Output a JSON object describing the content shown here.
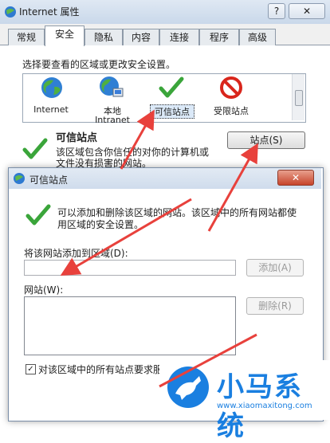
{
  "outer_window": {
    "title": "Internet 属性",
    "help_label": "?",
    "close_label": "✕",
    "tabs": [
      "常规",
      "安全",
      "隐私",
      "内容",
      "连接",
      "程序",
      "高级"
    ],
    "active_tab": "安全",
    "zone_prompt": "选择要查看的区域或更改安全设置。",
    "zones": [
      {
        "label": "Internet",
        "icon": "globe-icon"
      },
      {
        "label": "本地 Intranet",
        "line1": "本地",
        "line2": "Intranet",
        "icon": "intranet-icon"
      },
      {
        "label": "可信站点",
        "icon": "checkmark-icon"
      },
      {
        "label": "受限站点",
        "icon": "forbidden-icon"
      }
    ],
    "zone_heading": "可信站点",
    "zone_desc_line1": "该区域包含你信任的对你的计算机或",
    "zone_desc_line2": "文件没有损害的网站。",
    "sites_button": "站点(S)"
  },
  "dialog": {
    "title": "可信站点",
    "close_label": "✕",
    "info_line1": "可以添加和删除该区域的网站。该区域中的所有网站都使",
    "info_line2": "用区域的安全设置。",
    "add_label": "将该网站添加到区域(D):",
    "add_input_value": "",
    "add_button": "添加(A)",
    "websites_label": "网站(W):",
    "remove_button": "删除(R)",
    "require_https_label": "对该区域中的所有站点要求服务器验证(https:)",
    "require_https_checked": true
  },
  "brand": {
    "name": "小马系统",
    "url": "www.xiaomaxitong.com"
  },
  "colors": {
    "annotation_arrow": "#e8413c",
    "check_green": "#3aa53a",
    "brand_blue": "#1a7fe0"
  }
}
